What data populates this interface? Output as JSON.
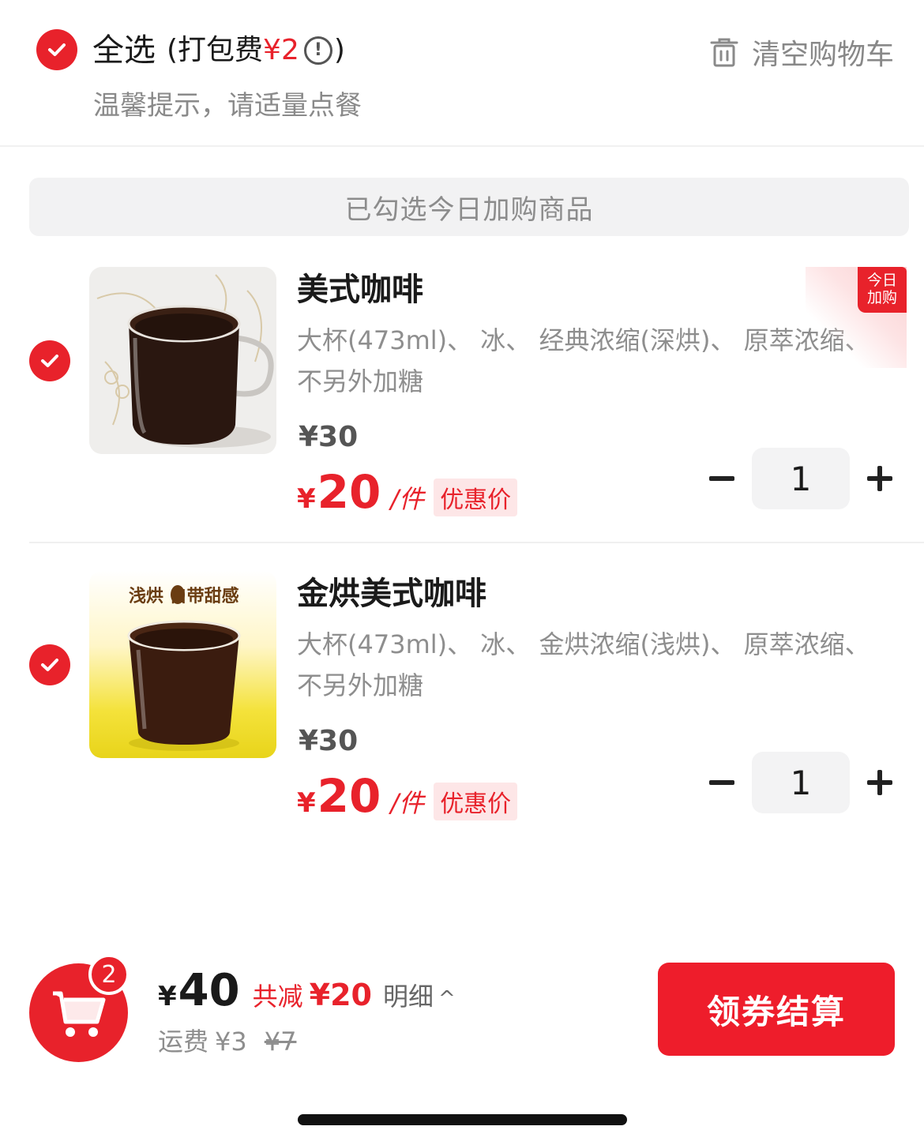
{
  "header": {
    "select_all_label": "全选",
    "packing_fee_label": "(打包费",
    "packing_fee_value": "¥2",
    "packing_fee_close": ")",
    "info_glyph": "!",
    "clear_cart_label": "清空购物车",
    "tip": "温馨提示，请适量点餐"
  },
  "banner": {
    "text": "已勾选今日加购商品"
  },
  "items": [
    {
      "name": "美式咖啡",
      "spec": "大杯(473ml)、 冰、 经典浓缩(深烘)、 原萃浓缩、 不另外加糖",
      "original_price": "¥30",
      "deal_currency": "¥",
      "deal_amount": "20",
      "deal_unit": "/件",
      "deal_badge": "优惠价",
      "quantity": "1",
      "corner_tag": "今日 加购"
    },
    {
      "name": "金烘美式咖啡",
      "spec": "大杯(473ml)、 冰、 金烘浓缩(浅烘)、 原萃浓缩、 不另外加糖",
      "original_price": "¥30",
      "deal_currency": "¥",
      "deal_amount": "20",
      "deal_unit": "/件",
      "deal_badge": "优惠价",
      "quantity": "1",
      "image_tag": "浅烘 自带甜感"
    }
  ],
  "footer": {
    "cart_count": "2",
    "total_currency": "¥",
    "total_amount": "40",
    "savings_label": "共减",
    "savings_value": "¥20",
    "detail_label": "明细",
    "detail_caret": "^",
    "delivery_label": "运费",
    "delivery_fee": "¥3",
    "delivery_original": "¥7",
    "checkout_label": "领券结算"
  },
  "colors": {
    "accent": "#e8222b",
    "muted_text": "#8e8e8e",
    "banner_bg": "#f2f2f3"
  },
  "icons": [
    "check-icon",
    "info-icon",
    "trash-icon",
    "minus-icon",
    "plus-icon",
    "cart-icon",
    "caret-up-icon"
  ]
}
